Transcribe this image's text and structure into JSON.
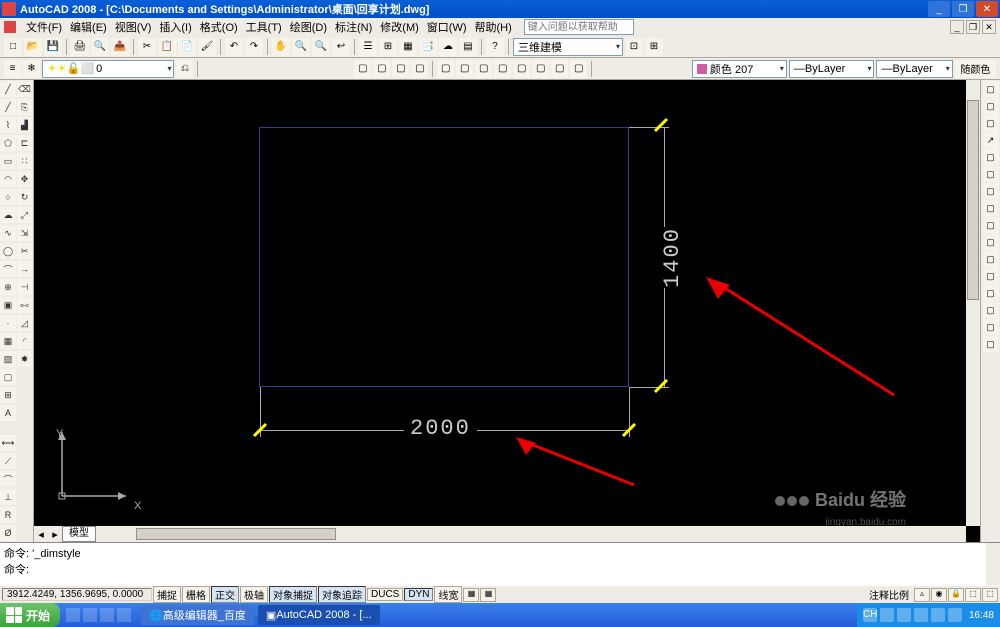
{
  "window": {
    "title": "AutoCAD 2008 - [C:\\Documents and Settings\\Administrator\\桌面\\回享计划.dwg]"
  },
  "menu": {
    "file": "文件(F)",
    "edit": "编辑(E)",
    "view": "视图(V)",
    "insert": "插入(I)",
    "format": "格式(O)",
    "tools": "工具(T)",
    "draw": "绘图(D)",
    "dimension": "标注(N)",
    "modify": "修改(M)",
    "window": "窗口(W)",
    "help": "帮助(H)",
    "search_ph": "键入问题以获取帮助"
  },
  "toolbar": {
    "layer_value": "0",
    "vstyle_value": "三维建模",
    "color_value": "颜色 207",
    "color_swatch": "#cf5fa0",
    "linetype_value": "ByLayer",
    "lineweight_value": "ByLayer"
  },
  "props_btn": "随颜色",
  "drawing": {
    "dim_h": "2000",
    "dim_v": "1400",
    "ucs_x": "X",
    "ucs_y": "Y"
  },
  "cmd": {
    "l1": "命令: '_dimstyle",
    "l2": "命令:"
  },
  "status": {
    "coords": "3912.4249, 1356.9695, 0.0000",
    "snap": "捕捉",
    "grid": "栅格",
    "ortho": "正交",
    "polar": "极轴",
    "osnap": "对象捕捉",
    "otrack": "对象追踪",
    "ducs": "DUCS",
    "dyn": "DYN",
    "lwt": "线宽",
    "scale": "注释比例"
  },
  "model_tab": "模型",
  "watermark": {
    "text": "经验",
    "url": "jingyan.baidu.com"
  },
  "taskbar": {
    "start": "开始",
    "task1": "高级编辑器_百度",
    "task2": "AutoCAD 2008 - [...",
    "lang": "CH",
    "time": "16:48"
  }
}
